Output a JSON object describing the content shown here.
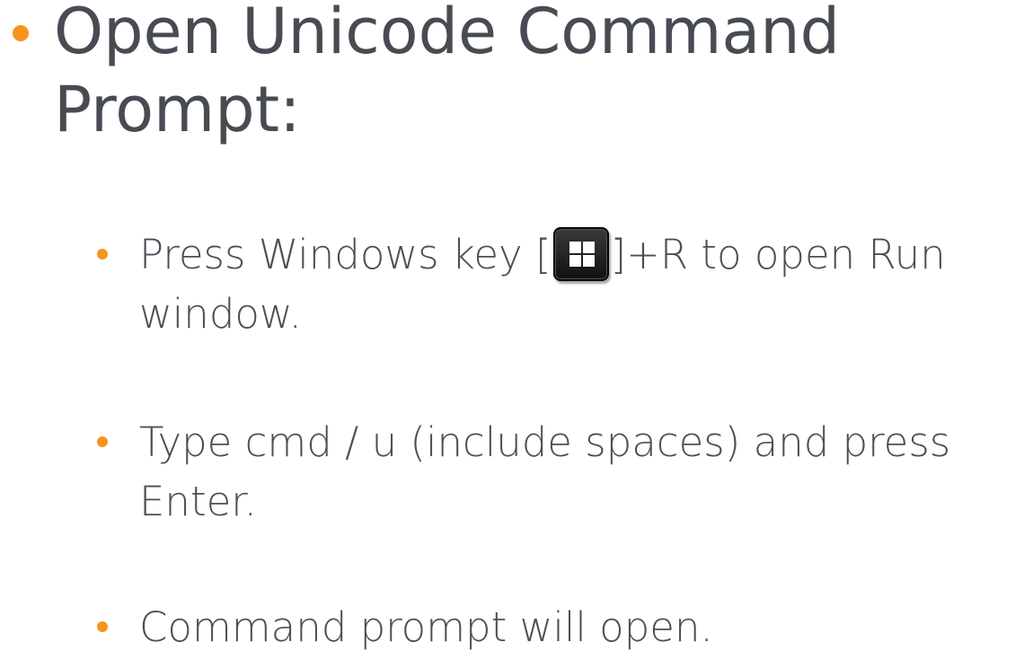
{
  "slide": {
    "title": "Open Unicode Command Prompt:",
    "accent_color": "#f7941d",
    "text_color": "#474b52",
    "items": [
      {
        "before": "Press Windows key [",
        "icon": "windows-key-icon",
        "after": "]+R to open Run window."
      },
      {
        "text": "Type cmd / u (include spaces) and press Enter."
      },
      {
        "text": "Command prompt will open."
      }
    ]
  }
}
